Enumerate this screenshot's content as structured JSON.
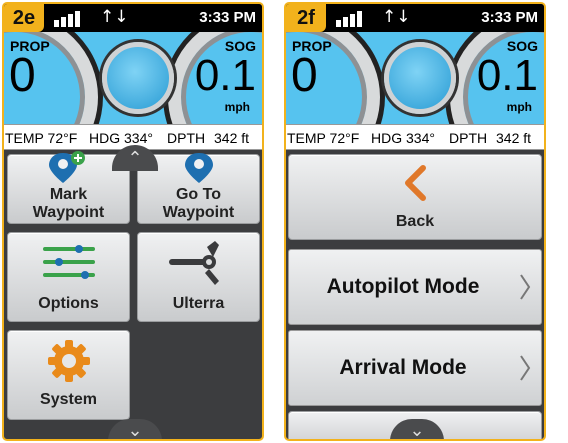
{
  "screens": [
    {
      "tag": "2e",
      "status": {
        "time": "3:33 PM",
        "signal_icon": "signal-bars-icon",
        "transfer_icon": "data-transfer-icon",
        "transfer_glyph": "↑↓"
      },
      "gauges": {
        "prop_label": "PROP",
        "prop_value": "0",
        "sog_label": "SOG",
        "sog_value": "0.1",
        "sog_unit": "mph"
      },
      "info": {
        "temp": "TEMP 72°F",
        "hdg": "HDG 334°",
        "dpth_label": "DPTH",
        "dpth_value": "342 ft"
      },
      "tiles": [
        {
          "label_line1": "Mark",
          "label_line2": "Waypoint",
          "icon": "map-pin-plus-icon"
        },
        {
          "label_line1": "Go To",
          "label_line2": "Waypoint",
          "icon": "map-pin-icon"
        },
        {
          "label": "Options",
          "icon": "sliders-icon"
        },
        {
          "label": "Ulterra",
          "icon": "trolling-motor-icon"
        },
        {
          "label": "System",
          "icon": "gear-icon"
        }
      ],
      "collapse_glyph": "⌃",
      "expand_glyph": "⌄"
    },
    {
      "tag": "2f",
      "status": {
        "time": "3:33 PM",
        "signal_icon": "signal-bars-icon",
        "transfer_icon": "data-transfer-icon",
        "transfer_glyph": "↑↓"
      },
      "gauges": {
        "prop_label": "PROP",
        "prop_value": "0",
        "sog_label": "SOG",
        "sog_value": "0.1",
        "sog_unit": "mph"
      },
      "info": {
        "temp": "TEMP 72°F",
        "hdg": "HDG 334°",
        "dpth_label": "DPTH",
        "dpth_value": "342 ft"
      },
      "back": {
        "label": "Back",
        "icon": "chevron-left-icon"
      },
      "menu": [
        {
          "label": "Autopilot Mode",
          "icon": "chevron-right-icon"
        },
        {
          "label": "Arrival Mode",
          "icon": "chevron-right-icon"
        }
      ],
      "expand_glyph": "⌄"
    }
  ],
  "colors": {
    "frame": "#f2b21c",
    "gauge_blue": "#56c3ef",
    "tile_bg": "#dcdedf",
    "back_orange": "#e0782a",
    "screen_bg": "#3c3d3f"
  }
}
